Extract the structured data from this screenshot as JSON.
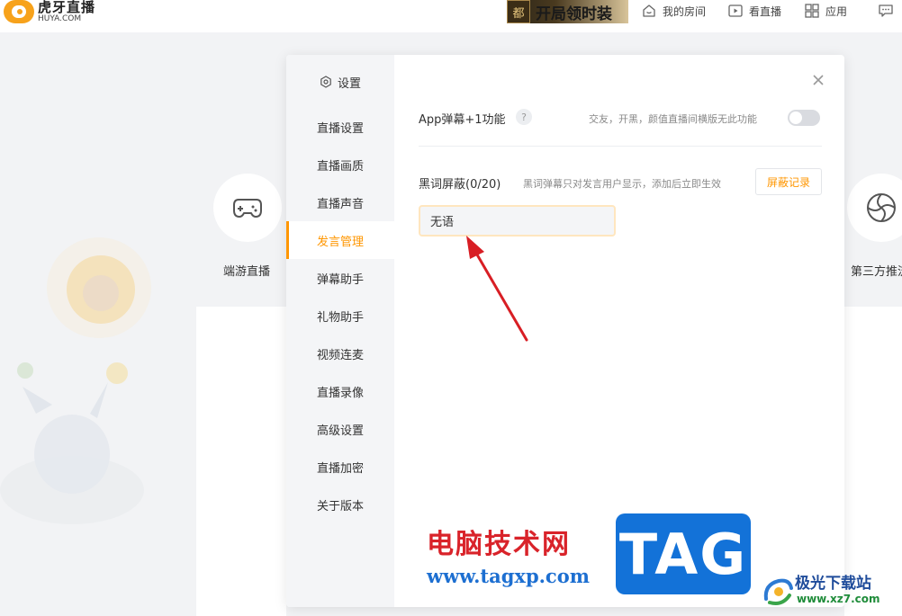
{
  "app": {
    "logo_cn": "虎牙直播",
    "logo_en": "HUYA.COM"
  },
  "header": {
    "promo_badge": "都",
    "promo_text": "开局领时装",
    "nav": {
      "my_room": "我的房间",
      "watch_live": "看直播",
      "apps": "应用"
    }
  },
  "background": {
    "left_tile_label": "端游直播",
    "right_tile_label": "第三方推流"
  },
  "dialog": {
    "sidebar": {
      "header": "设置",
      "items": [
        {
          "label": "直播设置"
        },
        {
          "label": "直播画质"
        },
        {
          "label": "直播声音"
        },
        {
          "label": "发言管理",
          "active": true
        },
        {
          "label": "弹幕助手"
        },
        {
          "label": "礼物助手"
        },
        {
          "label": "视频连麦"
        },
        {
          "label": "直播录像"
        },
        {
          "label": "高级设置"
        },
        {
          "label": "直播加密"
        },
        {
          "label": "关于版本"
        }
      ]
    },
    "app_danmu": {
      "title": "App弹幕+1功能",
      "help": "?",
      "description": "交友，开黑，颜值直播间横版无此功能",
      "enabled": false
    },
    "blacklist": {
      "title": "黑词屏蔽(0/20)",
      "description": "黑词弹幕只对发言用户显示，添加后立即生效",
      "record_button": "屏蔽记录",
      "input_value": "无语"
    }
  },
  "colors": {
    "accent": "#ff9600",
    "arrow": "#d81e24"
  },
  "watermark": {
    "site_cn": "电脑技术网",
    "site_url": "www.tagxp.com",
    "tag": "TAG",
    "brand_cn": "极光下载站",
    "brand_url": "www.xz7.com"
  }
}
